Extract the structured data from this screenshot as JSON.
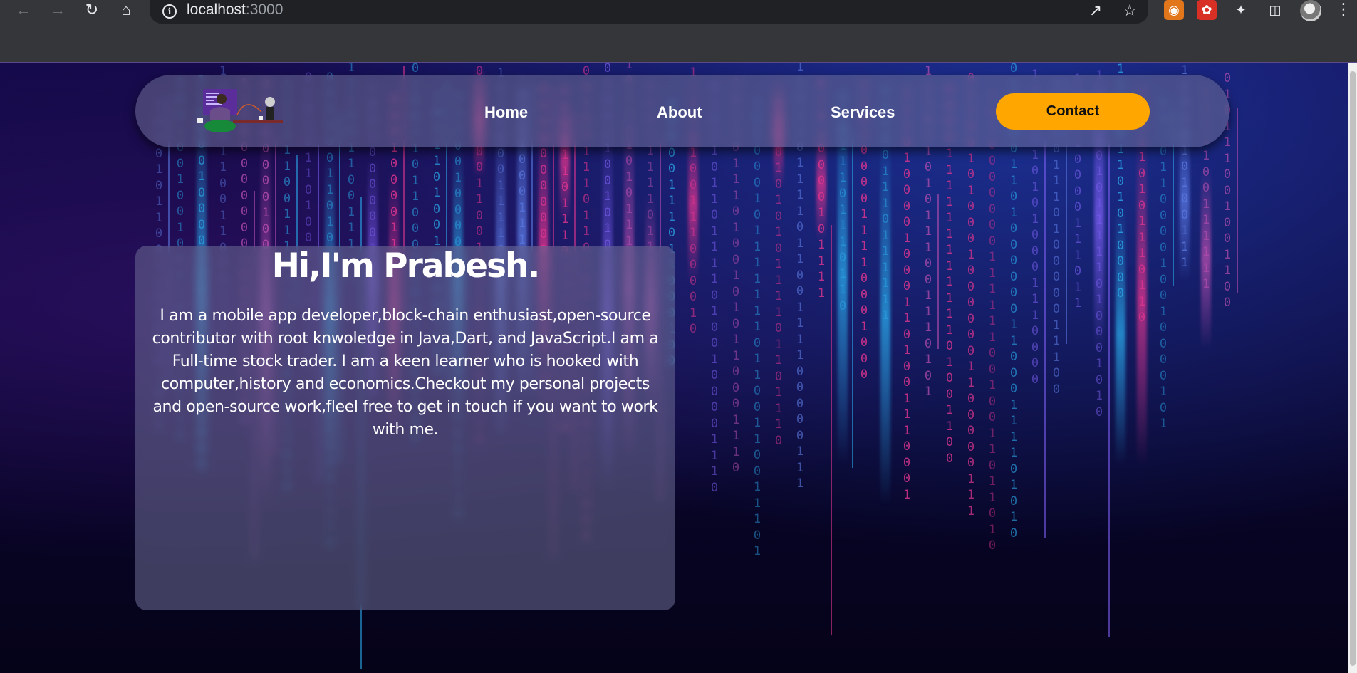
{
  "browser": {
    "url_host": "localhost",
    "url_port": ":3000"
  },
  "nav": {
    "links": [
      "Home",
      "About",
      "Services"
    ],
    "contact_label": "Contact"
  },
  "hero": {
    "title": "Hi,I'm Prabesh.",
    "description": "I am a mobile app developer,block-chain enthusiast,open-source contributor with root knwoledge in Java,Dart, and JavaScript.I am a Full-time stock trader. I am a keen learner who is hooked with computer,history and economics.Checkout my personal projects and open-source work,fleel free to get in touch if you want to work with me."
  },
  "colors": {
    "accent": "#ffa600",
    "matrix_pink": "#e0358f",
    "matrix_blue": "#2aa7e8",
    "matrix_violet": "#7b5ef0"
  },
  "icons": {
    "back": "arrow-left-icon",
    "forward": "arrow-right-icon",
    "reload": "reload-icon",
    "home": "home-icon",
    "info": "info-icon",
    "share": "share-icon",
    "star": "star-icon",
    "extensions": [
      "metamask-icon",
      "extension-icon",
      "puzzle-icon"
    ],
    "sidebar": "side-panel-icon",
    "menu": "kebab-menu-icon"
  }
}
